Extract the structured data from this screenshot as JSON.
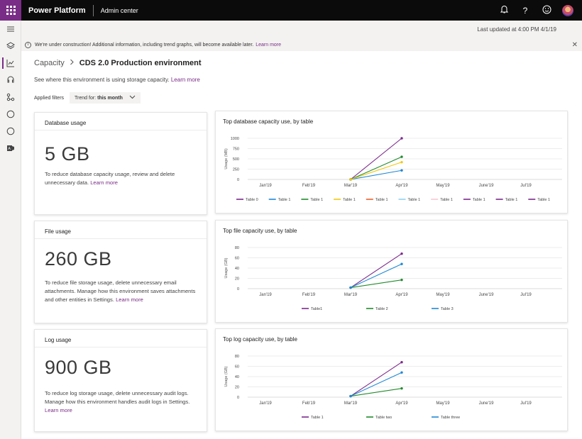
{
  "topbar": {
    "app_name": "Power Platform",
    "section": "Admin center",
    "icons": [
      "waffle-icon",
      "bell-icon",
      "help-icon",
      "smiley-icon",
      "avatar"
    ]
  },
  "rail": {
    "icons": [
      "hamburger-icon",
      "environments-icon",
      "analytics-icon",
      "help-support-icon",
      "data-integration-icon",
      "circle-icon",
      "circle-icon",
      "power-apps-icon"
    ]
  },
  "last_updated": "Last updated at 4:00 PM 4/1/19",
  "banner": {
    "text": "We're under construction! Additional information, including trend graphs, will become available later.",
    "link": "Learn more"
  },
  "breadcrumb": {
    "parent": "Capacity",
    "separator": ">",
    "current": "CDS 2.0 Production environment"
  },
  "description": {
    "text": "See where this environment is using storage capacity.",
    "link": "Learn more"
  },
  "filters": {
    "label": "Applied filters",
    "dropdown_prefix": "Trend for:",
    "dropdown_value": "this month"
  },
  "cards": [
    {
      "title": "Database usage",
      "value": "5 GB",
      "note": "To reduce database capacity usage, review and delete unnecessary data.",
      "link": "Learn more"
    },
    {
      "title": "File usage",
      "value": "260 GB",
      "note": "To reduce file storage usage, delete unnecessary email attachments. Manage how this environment saves attachments and other entities in Settings.",
      "link": "Learn more"
    },
    {
      "title": "Log usage",
      "value": "900 GB",
      "note": "To reduce log storage usage, delete unnecessary audit logs. Manage how this environment handles audit logs in Settings.",
      "link": "Learn more"
    }
  ],
  "colors": {
    "purple": "#7b2a8c",
    "blue": "#1f88d6",
    "green": "#218a2c",
    "yellow": "#f2c811",
    "orange": "#e8612c",
    "lightblue": "#8fd0f0",
    "pink": "#f7c6d4",
    "accent": "#7a2d86"
  },
  "chart_data": [
    {
      "type": "line",
      "title": "Top database capacity use, by table",
      "ylabel": "Usage (MB)",
      "ylim": [
        0,
        1000
      ],
      "yticks": [
        0,
        250,
        500,
        750,
        1000
      ],
      "categories": [
        "Jan'19",
        "Feb'19",
        "Mar'19",
        "Apr'19",
        "May'19",
        "June'19",
        "Jul'19"
      ],
      "series": [
        {
          "name": "Table 0",
          "color": "#7b2a8c",
          "values": [
            null,
            null,
            0,
            1000,
            null,
            null,
            null
          ]
        },
        {
          "name": "Table 1",
          "color": "#1f88d6",
          "values": [
            null,
            null,
            0,
            220,
            null,
            null,
            null
          ]
        },
        {
          "name": "Table 1",
          "color": "#218a2c",
          "values": [
            null,
            null,
            0,
            550,
            null,
            null,
            null
          ]
        },
        {
          "name": "Table 1",
          "color": "#f2c811",
          "values": [
            null,
            null,
            0,
            420,
            null,
            null,
            null
          ]
        },
        {
          "name": "Table 1",
          "color": "#e8612c",
          "values": []
        },
        {
          "name": "Table 1",
          "color": "#8fd0f0",
          "values": []
        },
        {
          "name": "Table 1",
          "color": "#f7c6d4",
          "values": []
        },
        {
          "name": "Table 1",
          "color": "#7b2a8c",
          "values": []
        },
        {
          "name": "Table 1",
          "color": "#7b2a8c",
          "values": []
        },
        {
          "name": "Table 1",
          "color": "#7b2a8c",
          "values": []
        }
      ]
    },
    {
      "type": "line",
      "title": "Top file capacity use, by table",
      "ylabel": "Usage (GB)",
      "ylim": [
        0,
        80
      ],
      "yticks": [
        0,
        20,
        40,
        60,
        80
      ],
      "categories": [
        "Jan'19",
        "Feb'19",
        "Mar'19",
        "Apr'19",
        "May'19",
        "June'19",
        "Jul'19"
      ],
      "series": [
        {
          "name": "Table1",
          "color": "#7b2a8c",
          "values": [
            null,
            null,
            2,
            68,
            null,
            null,
            null
          ]
        },
        {
          "name": "Table 2",
          "color": "#218a2c",
          "values": [
            null,
            null,
            2,
            17,
            null,
            null,
            null
          ]
        },
        {
          "name": "Table 3",
          "color": "#1f88d6",
          "values": [
            null,
            null,
            2,
            48,
            null,
            null,
            null
          ]
        }
      ]
    },
    {
      "type": "line",
      "title": "Top log capacity use, by table",
      "ylabel": "Usage (GB)",
      "ylim": [
        0,
        80
      ],
      "yticks": [
        0,
        20,
        40,
        60,
        80
      ],
      "categories": [
        "Jan'19",
        "Feb'19",
        "Mar'19",
        "Apr'19",
        "May'19",
        "June'19",
        "Jul'19"
      ],
      "series": [
        {
          "name": "Table 1",
          "color": "#7b2a8c",
          "values": [
            null,
            null,
            2,
            68,
            null,
            null,
            null
          ]
        },
        {
          "name": "Table two",
          "color": "#218a2c",
          "values": [
            null,
            null,
            2,
            17,
            null,
            null,
            null
          ]
        },
        {
          "name": "Table three",
          "color": "#1f88d6",
          "values": [
            null,
            null,
            2,
            48,
            null,
            null,
            null
          ]
        }
      ]
    }
  ]
}
